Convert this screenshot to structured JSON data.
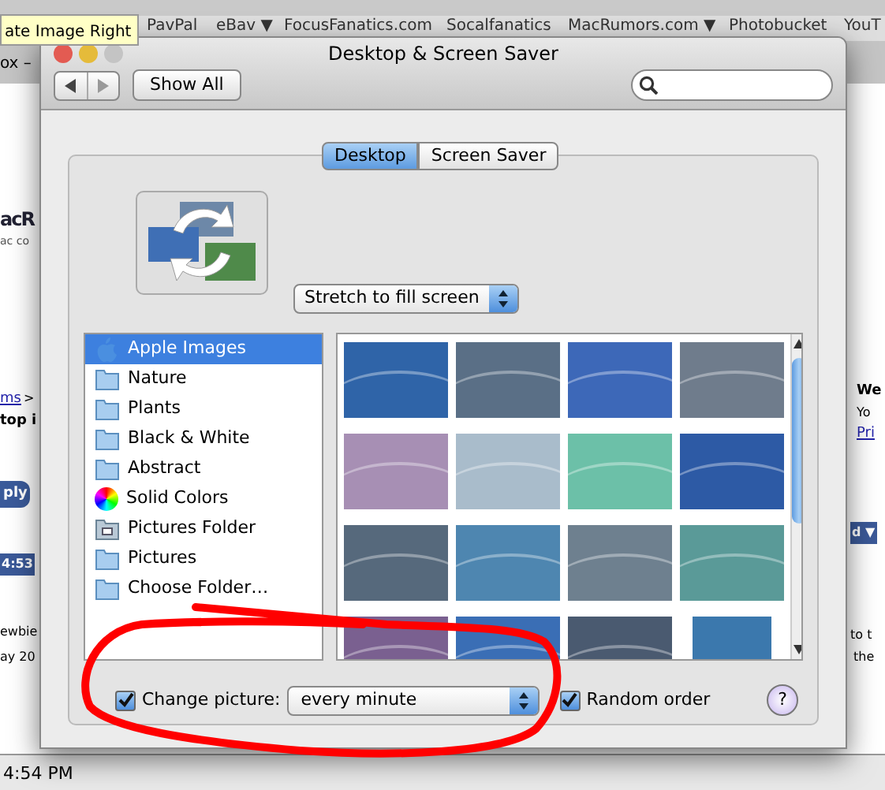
{
  "browser": {
    "bookmarks": [
      {
        "label": "PavPal"
      },
      {
        "label": "eBav ▼"
      },
      {
        "label": "FocusFanatics.com"
      },
      {
        "label": "Socalfanatics"
      },
      {
        "label": "MacRumors.com ▼"
      },
      {
        "label": "Photobucket"
      },
      {
        "label": "YouT"
      }
    ],
    "tooltip": "ate Image Right",
    "tab_title": "ox –",
    "fragments": [
      {
        "kind": "logo",
        "text": "acR"
      },
      {
        "kind": "small",
        "text": "ac co"
      },
      {
        "kind": "link",
        "text": "ms"
      },
      {
        "kind": "plain",
        "text": ">"
      },
      {
        "kind": "heading",
        "text": "top i"
      },
      {
        "kind": "button",
        "text": "ply"
      },
      {
        "kind": "bar",
        "text": "4:53"
      },
      {
        "kind": "plain",
        "text": "ewbie"
      },
      {
        "kind": "plain",
        "text": "ay 20"
      },
      {
        "kind": "heading",
        "text": "We"
      },
      {
        "kind": "plain",
        "text": "Yo"
      },
      {
        "kind": "link",
        "text": "Pri"
      },
      {
        "kind": "bar",
        "text": "d ▼"
      },
      {
        "kind": "plain",
        "text": "to t"
      },
      {
        "kind": "plain",
        "text": "the"
      }
    ],
    "status_bar": "4:54 PM"
  },
  "window": {
    "title": "Desktop & Screen Saver",
    "show_all": "Show All"
  },
  "tabs": [
    {
      "label": "Desktop",
      "selected": true
    },
    {
      "label": "Screen Saver",
      "selected": false
    }
  ],
  "fit_menu": "Stretch to fill screen",
  "sources": [
    {
      "label": "Apple Images",
      "kind": "apple",
      "selected": true
    },
    {
      "label": "Nature",
      "kind": "folder",
      "selected": false
    },
    {
      "label": "Plants",
      "kind": "folder",
      "selected": false
    },
    {
      "label": "Black & White",
      "kind": "folder",
      "selected": false
    },
    {
      "label": "Abstract",
      "kind": "folder",
      "selected": false
    },
    {
      "label": "Solid Colors",
      "kind": "colors",
      "selected": false
    },
    {
      "label": "Pictures Folder",
      "kind": "pictures",
      "selected": false
    },
    {
      "label": "Pictures",
      "kind": "folder",
      "selected": false
    },
    {
      "label": "Choose Folder…",
      "kind": "folder",
      "selected": false
    }
  ],
  "thumbnails": [
    {
      "color": "#2f64a8"
    },
    {
      "color": "#5a6f86"
    },
    {
      "color": "#3d68b8"
    },
    {
      "color": "#6f7c8c"
    },
    {
      "color": "#a78fb4"
    },
    {
      "color": "#a9bccb"
    },
    {
      "color": "#6cc0a8"
    },
    {
      "color": "#2d5aa5"
    },
    {
      "color": "#56697c"
    },
    {
      "color": "#4e86b0"
    },
    {
      "color": "#6e808f"
    },
    {
      "color": "#5a9a98"
    },
    {
      "color": "#7a6090"
    },
    {
      "color": "#3a6eb5"
    },
    {
      "color": "#4a5a70"
    },
    {
      "color": "#3b78ad"
    }
  ],
  "change_picture": {
    "checked": true,
    "label": "Change picture:",
    "interval": "every minute"
  },
  "random_order": {
    "checked": true,
    "label": "Random order"
  },
  "help": "?"
}
